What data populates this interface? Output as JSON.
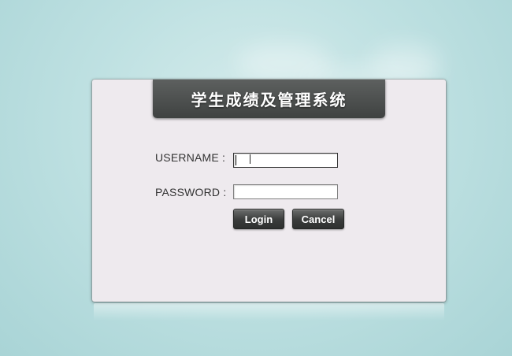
{
  "app": {
    "title": "学生成绩及管理系统"
  },
  "form": {
    "username_label": "USERNAME :",
    "username_value": "",
    "password_label": "PASSWORD :",
    "password_value": ""
  },
  "buttons": {
    "login_label": "Login",
    "cancel_label": "Cancel"
  },
  "colors": {
    "background": "#bfe1e2",
    "panel": "#eeeaee",
    "title_bar": "#4a4d4c",
    "button": "#3a3c3b"
  }
}
